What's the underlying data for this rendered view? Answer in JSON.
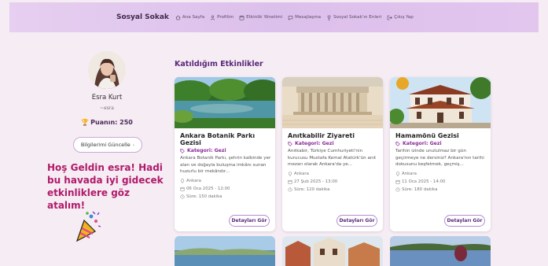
{
  "navbar": {
    "brand": "Sosyal Sokak",
    "items": [
      {
        "label": "Ana Sayfa",
        "icon": "home-icon"
      },
      {
        "label": "Profilim",
        "icon": "user-icon"
      },
      {
        "label": "Etkinlik Yönetimi",
        "icon": "calendar-icon"
      },
      {
        "label": "Mesajlaşma",
        "icon": "chat-icon"
      },
      {
        "label": "Sosyal Sokak'ın Enleri",
        "icon": "trophy-icon"
      },
      {
        "label": "Çıkış Yap",
        "icon": "logout-icon"
      }
    ]
  },
  "profile": {
    "name": "Esra Kurt",
    "handle": "~esra",
    "points_label": "Puanın: 250",
    "update_button": "Bilgilerimi Güncelle",
    "welcome": "Hoş Geldin esra! Hadi bu havada iyi gidecek etkinliklere göz atalım!"
  },
  "section_title": "Katıldığım Etkinlikler",
  "events": [
    {
      "title": "Ankara Botanik Parkı Gezisi",
      "category": "Kategori: Gezi",
      "description": "Ankara Botanik Parkı, şehrin kalbinde yer alan ve doğayla buluşma imkânı sunan huzurlu bir mekândır...",
      "location": "Ankara",
      "date": "06 Oca 2025 - 12:00",
      "duration": "Süre: 150 dakika",
      "button": "Detayları Gör"
    },
    {
      "title": "Anıtkabilir Ziyareti",
      "category": "Kategori: Gezi",
      "description": "Anıtkabir, Türkiye Cumhuriyeti'nin kurucusu Mustafa Kemal Atatürk'ün anıt mezarı olarak Ankara'da ye...",
      "location": "Ankara",
      "date": "27 Şub 2025 - 13:00",
      "duration": "Süre: 120 dakika",
      "button": "Detayları Gör"
    },
    {
      "title": "Hamamönü Gezisi",
      "category": "Kategori: Gezi",
      "description": "Tarihin izinde unutulmaz bir gün geçirmeye ne dersiniz? Ankara'nın tarihi dokusunu keşfetmek, geçmiş...",
      "location": "Ankara",
      "date": "11 Oca 2025 - 14:00",
      "duration": "Süre: 180 dakika",
      "button": "Detayları Gör"
    }
  ],
  "colors": {
    "accent": "#5a2a7a",
    "welcome": "#b01a6a",
    "navbar": "#dcc0ec",
    "background": "#f6ecf3"
  }
}
